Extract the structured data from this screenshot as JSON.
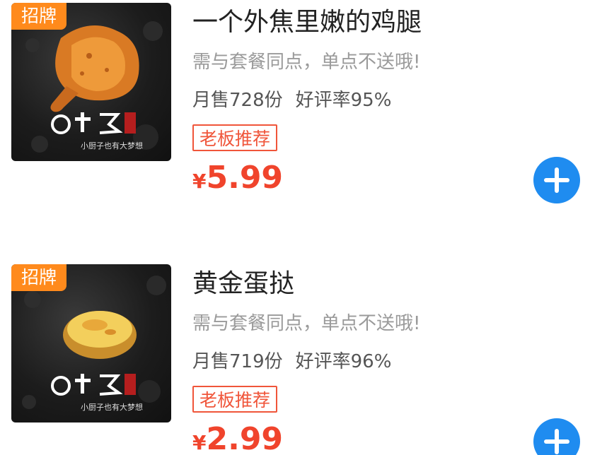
{
  "items": [
    {
      "badge": "招牌",
      "name": "一个外焦里嫩的鸡腿",
      "note": "需与套餐同点，单点不送哦!",
      "monthly_sales": "月售728份",
      "rating": "好评率95%",
      "tag": "老板推荐",
      "currency": "¥",
      "price": "5.99",
      "image_icon": "fried-chicken-leg-icon"
    },
    {
      "badge": "招牌",
      "name": "黄金蛋挞",
      "note": "需与套餐同点，单点不送哦!",
      "monthly_sales": "月售719份",
      "rating": "好评率96%",
      "tag": "老板推荐",
      "currency": "¥",
      "price": "2.99",
      "image_icon": "egg-tart-icon"
    }
  ],
  "colors": {
    "badge_bg": "#ff8a1c",
    "tag_red": "#f0553a",
    "price_red": "#f0442c",
    "add_button_blue": "#1f8cf0"
  }
}
